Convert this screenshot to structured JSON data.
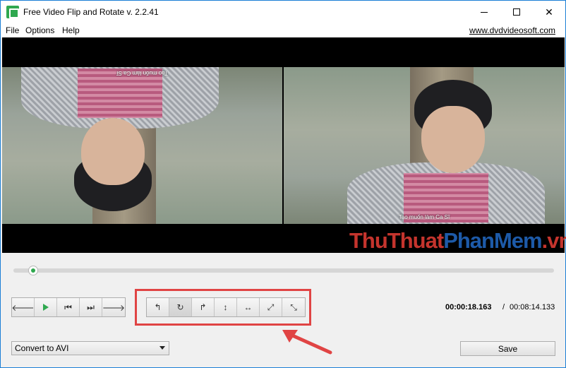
{
  "window": {
    "title": "Free Video Flip and Rotate v. 2.2.41",
    "controls": {
      "minimize": "—",
      "maximize": "☐",
      "close": "✕"
    }
  },
  "menu": {
    "items": [
      "File",
      "Options",
      "Help"
    ],
    "site_link": "www.dvdvideosoft.com"
  },
  "preview": {
    "left_subtitle": "Tao muốn làm Ca Sĩ",
    "right_subtitle": "Tao muốn làm Ca Sĩ"
  },
  "watermark": {
    "part_a": "ThuThuat",
    "part_b": "PhanMem",
    "part_c": ".vn"
  },
  "seek": {
    "position_fraction": 0.036
  },
  "playback": {
    "buttons": [
      {
        "name": "step-back",
        "glyph": "🡐"
      },
      {
        "name": "play",
        "glyph": ""
      },
      {
        "name": "previous",
        "glyph": "⏮"
      },
      {
        "name": "next",
        "glyph": "⏭"
      },
      {
        "name": "step-forward",
        "glyph": "🡒"
      }
    ]
  },
  "rotate": {
    "buttons": [
      {
        "name": "rotate-left",
        "glyph": "↰"
      },
      {
        "name": "rotate-180",
        "glyph": "↻"
      },
      {
        "name": "rotate-right",
        "glyph": "↱"
      },
      {
        "name": "flip-vertical",
        "glyph": "↕"
      },
      {
        "name": "flip-horizontal",
        "glyph": "↔"
      },
      {
        "name": "transpose",
        "glyph": "⤢"
      },
      {
        "name": "transverse",
        "glyph": "⤡"
      }
    ]
  },
  "time": {
    "current": "00:00:18.163",
    "separator": "/",
    "total": "00:08:14.133"
  },
  "output": {
    "format": "Convert to AVI",
    "save_label": "Save"
  },
  "colors": {
    "accent_green": "#2fa84f",
    "annotation_red": "#e04444"
  }
}
